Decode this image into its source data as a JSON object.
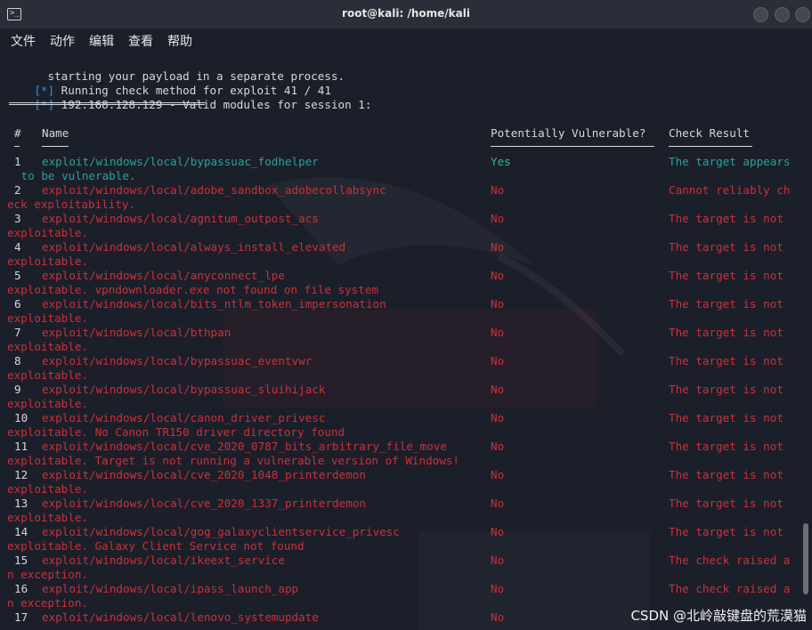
{
  "window": {
    "title": "root@kali: /home/kali",
    "icon": "terminal-icon"
  },
  "menu": [
    "文件",
    "动作",
    "编辑",
    "查看",
    "帮助"
  ],
  "header_lines": [
    {
      "prefix": "",
      "text": "  starting your payload in a separate process."
    },
    {
      "prefix": "[*]",
      "text": " Running check method for exploit 41 / 41"
    },
    {
      "prefix": "[*]",
      "text": " 192.168.128.129 - Valid modules for session 1:"
    }
  ],
  "separator": "============================",
  "columns": {
    "num": "#",
    "name": "Name",
    "vuln": "Potentially Vulnerable?",
    "result": "Check Result"
  },
  "rows": [
    {
      "num": "1",
      "name": "exploit/windows/local/bypassuac_fodhelper",
      "vuln": "Yes",
      "result": "The target appears",
      "cont": " to be vulnerable.",
      "status": "yes"
    },
    {
      "num": "2",
      "name": "exploit/windows/local/adobe_sandbox_adobecollabsync",
      "vuln": "No",
      "result": "Cannot reliably ch",
      "cont": "eck exploitability.",
      "status": "no"
    },
    {
      "num": "3",
      "name": "exploit/windows/local/agnitum_outpost_acs",
      "vuln": "No",
      "result": "The target is not",
      "cont": "exploitable.",
      "status": "no"
    },
    {
      "num": "4",
      "name": "exploit/windows/local/always_install_elevated",
      "vuln": "No",
      "result": "The target is not",
      "cont": "exploitable.",
      "status": "no"
    },
    {
      "num": "5",
      "name": "exploit/windows/local/anyconnect_lpe",
      "vuln": "No",
      "result": "The target is not",
      "cont": "exploitable. vpndownloader.exe not found on file system",
      "status": "no"
    },
    {
      "num": "6",
      "name": "exploit/windows/local/bits_ntlm_token_impersonation",
      "vuln": "No",
      "result": "The target is not",
      "cont": "exploitable.",
      "status": "no"
    },
    {
      "num": "7",
      "name": "exploit/windows/local/bthpan",
      "vuln": "No",
      "result": "The target is not",
      "cont": "exploitable.",
      "status": "no"
    },
    {
      "num": "8",
      "name": "exploit/windows/local/bypassuac_eventvwr",
      "vuln": "No",
      "result": "The target is not",
      "cont": "exploitable.",
      "status": "no"
    },
    {
      "num": "9",
      "name": "exploit/windows/local/bypassuac_sluihijack",
      "vuln": "No",
      "result": "The target is not",
      "cont": "exploitable.",
      "status": "no"
    },
    {
      "num": "10",
      "name": "exploit/windows/local/canon_driver_privesc",
      "vuln": "No",
      "result": "The target is not",
      "cont": "exploitable. No Canon TR150 driver directory found",
      "status": "no"
    },
    {
      "num": "11",
      "name": "exploit/windows/local/cve_2020_0787_bits_arbitrary_file_move",
      "vuln": "No",
      "result": "The target is not",
      "cont": "exploitable. Target is not running a vulnerable version of Windows!",
      "status": "no"
    },
    {
      "num": "12",
      "name": "exploit/windows/local/cve_2020_1048_printerdemon",
      "vuln": "No",
      "result": "The target is not",
      "cont": "exploitable.",
      "status": "no"
    },
    {
      "num": "13",
      "name": "exploit/windows/local/cve_2020_1337_printerdemon",
      "vuln": "No",
      "result": "The target is not",
      "cont": "exploitable.",
      "status": "no"
    },
    {
      "num": "14",
      "name": "exploit/windows/local/gog_galaxyclientservice_privesc",
      "vuln": "No",
      "result": "The target is not",
      "cont": "exploitable. Galaxy Client Service not found",
      "status": "no"
    },
    {
      "num": "15",
      "name": "exploit/windows/local/ikeext_service",
      "vuln": "No",
      "result": "The check raised a",
      "cont": "n exception.",
      "status": "no"
    },
    {
      "num": "16",
      "name": "exploit/windows/local/ipass_launch_app",
      "vuln": "No",
      "result": "The check raised a",
      "cont": "n exception.",
      "status": "no"
    },
    {
      "num": "17",
      "name": "exploit/windows/local/lenovo_systemupdate",
      "vuln": "No",
      "result": "",
      "cont": "",
      "status": "no"
    }
  ],
  "watermark": "CSDN @北岭敲键盘的荒漠猫",
  "colors": {
    "background": "#1b1f2a",
    "prompt_blue": "#3a8fd8",
    "vulnerable_green": "#2aa198",
    "not_vulnerable_red": "#c8323a",
    "text": "#d6d8dc"
  }
}
